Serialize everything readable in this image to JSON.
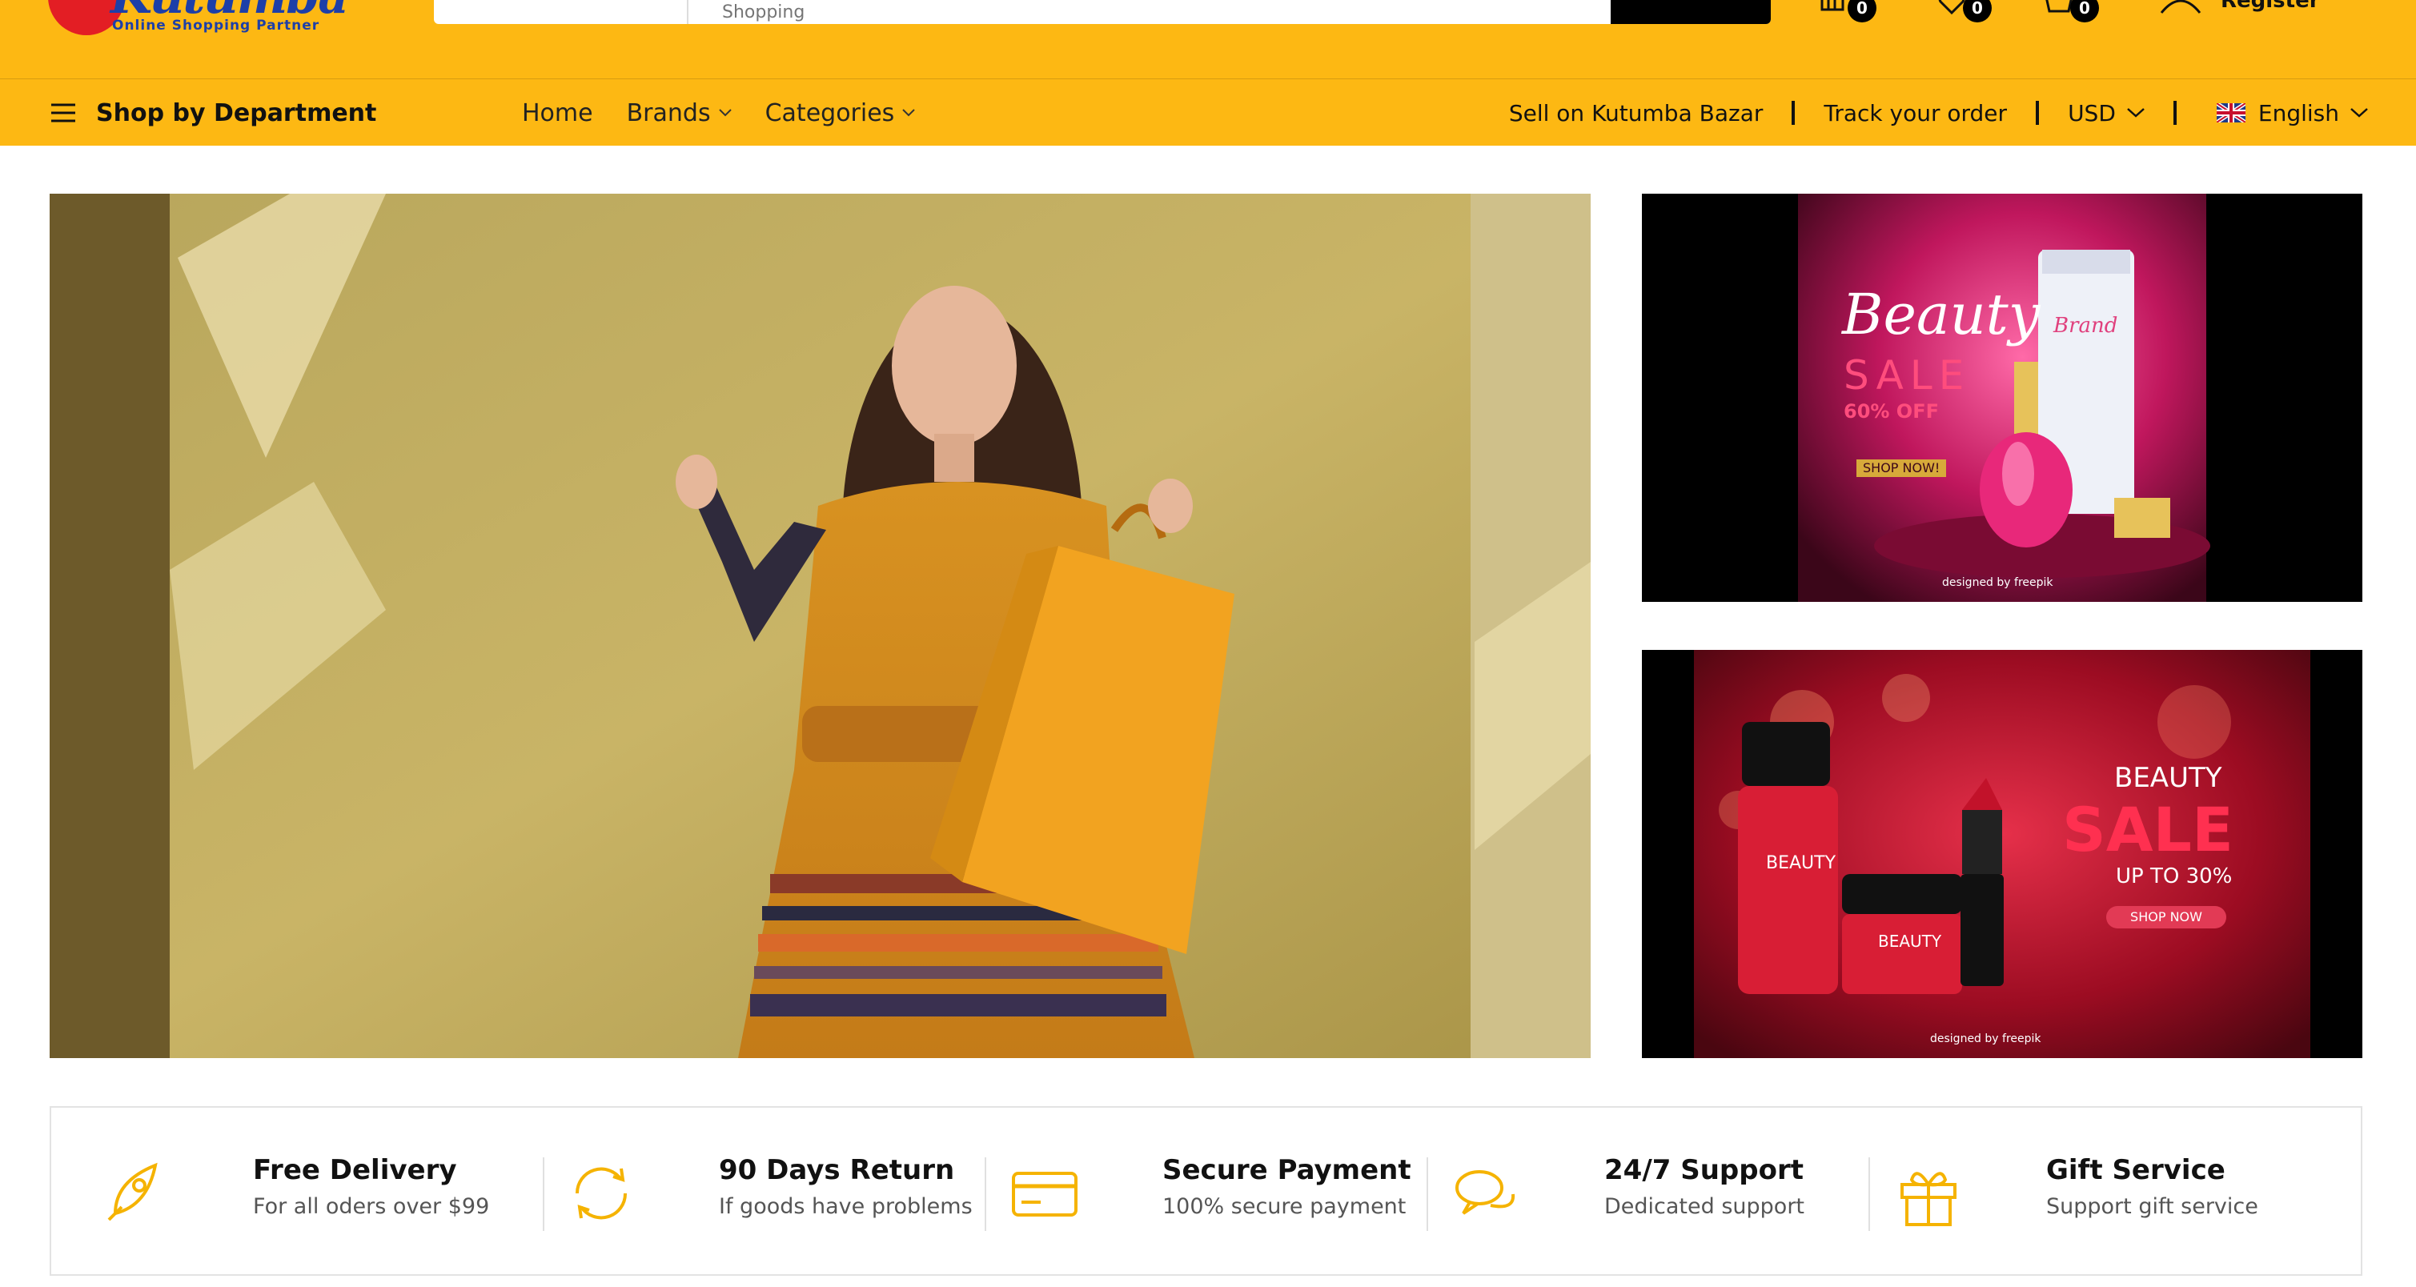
{
  "brand": {
    "logo_text": "Kutumba",
    "tagline": "Online Shopping Partner"
  },
  "search": {
    "placeholder": "Shopping"
  },
  "header": {
    "compare": {
      "icon": "compare-icon",
      "count": "0"
    },
    "wishlist": {
      "icon": "heart-icon",
      "count": "0"
    },
    "cart": {
      "icon": "cart-icon",
      "count": "0"
    },
    "register_label": "Register"
  },
  "nav": {
    "department_label": "Shop by Department",
    "links": [
      {
        "label": "Home"
      },
      {
        "label": "Brands"
      },
      {
        "label": "Categories"
      }
    ],
    "sell_label": "Sell on Kutumba Bazar",
    "track_label": "Track your order",
    "currency": "USD",
    "language": "English"
  },
  "banners": {
    "side_top": {
      "title": "Beauty",
      "sale": "SALE",
      "discount": "60% OFF",
      "brand": "Brand",
      "cta": "SHOP NOW!",
      "credit": "designed by freepik"
    },
    "side_bottom": {
      "line1": "BEAUTY",
      "line2": "SALE",
      "line3": "UP TO 30%",
      "cta": "SHOP NOW",
      "product": "BEAUTY",
      "credit": "designed by freepik"
    }
  },
  "features": [
    {
      "icon": "rocket-icon",
      "title": "Free Delivery",
      "subtitle": "For all oders over $99"
    },
    {
      "icon": "refresh-icon",
      "title": "90 Days Return",
      "subtitle": "If goods have problems"
    },
    {
      "icon": "credit-card-icon",
      "title": "Secure Payment",
      "subtitle": "100% secure payment"
    },
    {
      "icon": "chat-bubbles-icon",
      "title": "24/7 Support",
      "subtitle": "Dedicated support"
    },
    {
      "icon": "gift-icon",
      "title": "Gift Service",
      "subtitle": "Support gift service"
    }
  ],
  "colors": {
    "brand_yellow": "#fdb813",
    "icon_accent": "#f5b301",
    "red": "#e31e24",
    "blue": "#1d3fa8"
  }
}
